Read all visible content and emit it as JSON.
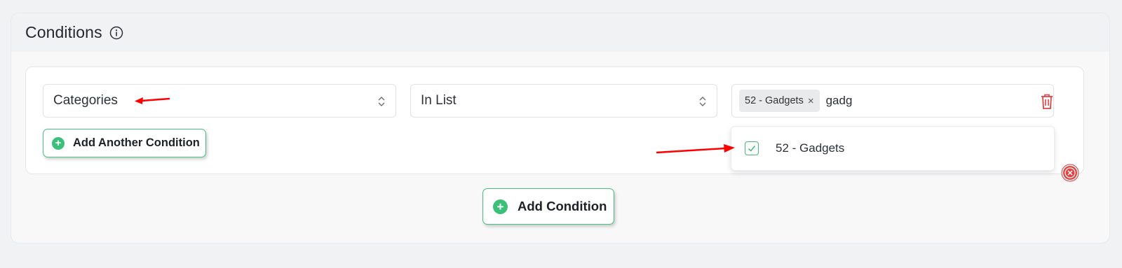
{
  "panel": {
    "title": "Conditions",
    "info_icon": "info-icon"
  },
  "condition": {
    "field_value": "Categories",
    "operator_value": "In List",
    "selected_tag": "52 - Gadgets",
    "tag_remove": "×",
    "search_text": "gadg"
  },
  "dropdown": {
    "options": [
      {
        "label": "52 - Gadgets",
        "checked": true
      }
    ]
  },
  "buttons": {
    "add_another_label": "Add Another Condition",
    "add_condition_label": "Add Condition",
    "plus_glyph": "+"
  },
  "colors": {
    "accent_green": "#3cbf78",
    "delete_red": "#e04545",
    "annotation_red": "#ff0000"
  }
}
